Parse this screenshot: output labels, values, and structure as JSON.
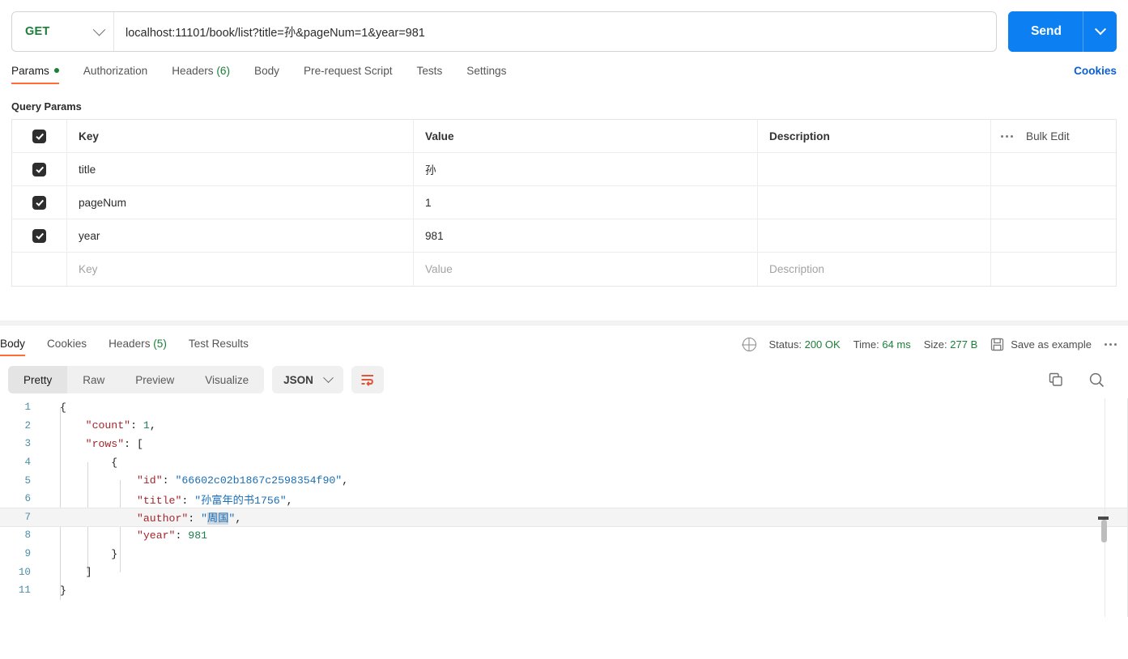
{
  "request": {
    "method": "GET",
    "url": "localhost:11101/book/list?title=孙&pageNum=1&year=981",
    "send_label": "Send",
    "cookies_label": "Cookies",
    "tabs": [
      {
        "label": "Params",
        "has_dot": true,
        "active": true
      },
      {
        "label": "Authorization",
        "active": false
      },
      {
        "label": "Headers",
        "count": "(6)",
        "active": false
      },
      {
        "label": "Body",
        "active": false
      },
      {
        "label": "Pre-request Script",
        "active": false
      },
      {
        "label": "Tests",
        "active": false
      },
      {
        "label": "Settings",
        "active": false
      }
    ]
  },
  "query_params": {
    "section_title": "Query Params",
    "headers": {
      "key": "Key",
      "value": "Value",
      "description": "Description"
    },
    "bulk_edit_label": "Bulk Edit",
    "rows": [
      {
        "checked": true,
        "key": "title",
        "value": "孙",
        "description": ""
      },
      {
        "checked": true,
        "key": "pageNum",
        "value": "1",
        "description": ""
      },
      {
        "checked": true,
        "key": "year",
        "value": "981",
        "description": ""
      }
    ],
    "placeholder_row": {
      "key": "Key",
      "value": "Value",
      "description": "Description"
    }
  },
  "response": {
    "tabs": [
      {
        "label": "Body",
        "active": true
      },
      {
        "label": "Cookies",
        "active": false
      },
      {
        "label": "Headers",
        "count": "(5)",
        "active": false
      },
      {
        "label": "Test Results",
        "active": false
      }
    ],
    "status_label": "Status:",
    "status_value": "200 OK",
    "time_label": "Time:",
    "time_value": "64 ms",
    "size_label": "Size:",
    "size_value": "277 B",
    "save_example_label": "Save as example",
    "view_modes": [
      {
        "label": "Pretty",
        "active": true
      },
      {
        "label": "Raw",
        "active": false
      },
      {
        "label": "Preview",
        "active": false
      },
      {
        "label": "Visualize",
        "active": false
      }
    ],
    "format": "JSON",
    "body_lines": [
      {
        "n": "1",
        "tokens": [
          {
            "t": "{",
            "c": "p"
          }
        ]
      },
      {
        "n": "2",
        "tokens": [
          {
            "t": "    ",
            "c": "p"
          },
          {
            "t": "\"count\"",
            "c": "k"
          },
          {
            "t": ": ",
            "c": "p"
          },
          {
            "t": "1",
            "c": "n"
          },
          {
            "t": ",",
            "c": "p"
          }
        ]
      },
      {
        "n": "3",
        "tokens": [
          {
            "t": "    ",
            "c": "p"
          },
          {
            "t": "\"rows\"",
            "c": "k"
          },
          {
            "t": ": [",
            "c": "p"
          }
        ]
      },
      {
        "n": "4",
        "tokens": [
          {
            "t": "        {",
            "c": "p"
          }
        ]
      },
      {
        "n": "5",
        "tokens": [
          {
            "t": "            ",
            "c": "p"
          },
          {
            "t": "\"id\"",
            "c": "k"
          },
          {
            "t": ": ",
            "c": "p"
          },
          {
            "t": "\"66602c02b1867c2598354f90\"",
            "c": "s"
          },
          {
            "t": ",",
            "c": "p"
          }
        ]
      },
      {
        "n": "6",
        "tokens": [
          {
            "t": "            ",
            "c": "p"
          },
          {
            "t": "\"title\"",
            "c": "k"
          },
          {
            "t": ": ",
            "c": "p"
          },
          {
            "t": "\"孙富年的书1756\"",
            "c": "s"
          },
          {
            "t": ",",
            "c": "p"
          }
        ]
      },
      {
        "n": "7",
        "highlight": true,
        "tokens": [
          {
            "t": "            ",
            "c": "p"
          },
          {
            "t": "\"author\"",
            "c": "k"
          },
          {
            "t": ": ",
            "c": "p"
          },
          {
            "t": "\"",
            "c": "s"
          },
          {
            "t": "周国",
            "c": "s sel"
          },
          {
            "t": "\"",
            "c": "s"
          },
          {
            "t": ",",
            "c": "p"
          }
        ]
      },
      {
        "n": "8",
        "tokens": [
          {
            "t": "            ",
            "c": "p"
          },
          {
            "t": "\"year\"",
            "c": "k"
          },
          {
            "t": ": ",
            "c": "p"
          },
          {
            "t": "981",
            "c": "n"
          }
        ]
      },
      {
        "n": "9",
        "tokens": [
          {
            "t": "        }",
            "c": "p"
          }
        ]
      },
      {
        "n": "10",
        "tokens": [
          {
            "t": "    ]",
            "c": "p"
          }
        ]
      },
      {
        "n": "11",
        "tokens": [
          {
            "t": "}",
            "c": "p"
          }
        ]
      }
    ]
  },
  "colors": {
    "accent_orange": "#ff6c37",
    "send_blue": "#0c7ff2",
    "status_green": "#1a7f37",
    "link_blue": "#0c5fd6"
  }
}
